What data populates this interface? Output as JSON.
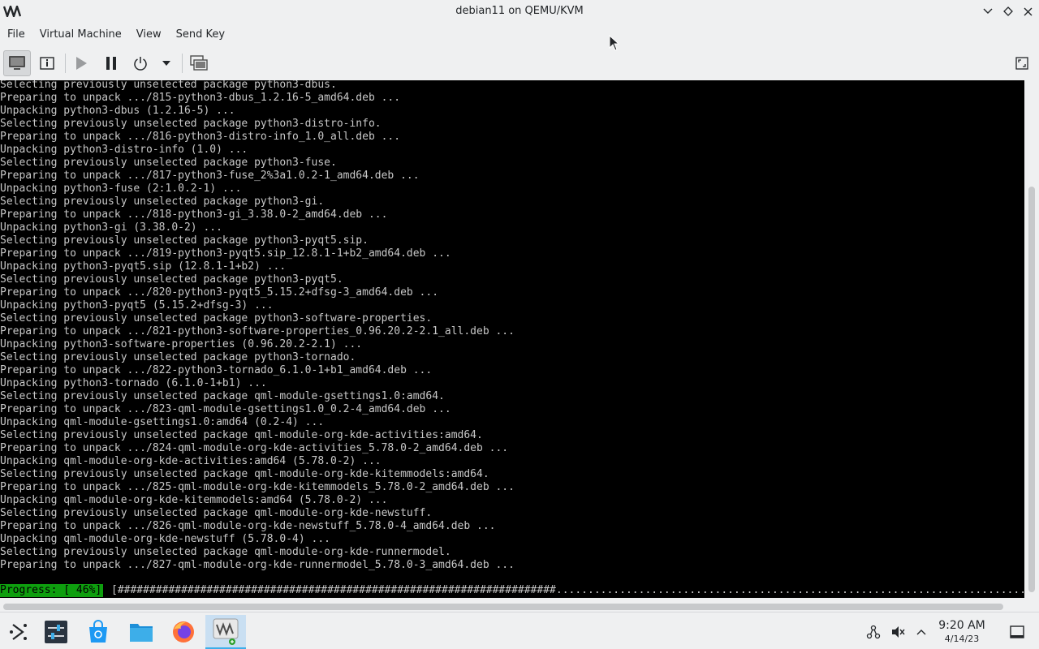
{
  "window": {
    "title": "debian11 on QEMU/KVM"
  },
  "menu": {
    "items": [
      "File",
      "Virtual Machine",
      "View",
      "Send Key"
    ]
  },
  "toolbar": {
    "buttons": [
      "console-view",
      "details-view",
      "run",
      "pause",
      "shutdown",
      "shutdown-menu",
      "snapshots",
      "fullscreen"
    ]
  },
  "console": {
    "lines": [
      "Selecting previously unselected package python3-dbus.",
      "Preparing to unpack .../815-python3-dbus_1.2.16-5_amd64.deb ...",
      "Unpacking python3-dbus (1.2.16-5) ...",
      "Selecting previously unselected package python3-distro-info.",
      "Preparing to unpack .../816-python3-distro-info_1.0_all.deb ...",
      "Unpacking python3-distro-info (1.0) ...",
      "Selecting previously unselected package python3-fuse.",
      "Preparing to unpack .../817-python3-fuse_2%3a1.0.2-1_amd64.deb ...",
      "Unpacking python3-fuse (2:1.0.2-1) ...",
      "Selecting previously unselected package python3-gi.",
      "Preparing to unpack .../818-python3-gi_3.38.0-2_amd64.deb ...",
      "Unpacking python3-gi (3.38.0-2) ...",
      "Selecting previously unselected package python3-pyqt5.sip.",
      "Preparing to unpack .../819-python3-pyqt5.sip_12.8.1-1+b2_amd64.deb ...",
      "Unpacking python3-pyqt5.sip (12.8.1-1+b2) ...",
      "Selecting previously unselected package python3-pyqt5.",
      "Preparing to unpack .../820-python3-pyqt5_5.15.2+dfsg-3_amd64.deb ...",
      "Unpacking python3-pyqt5 (5.15.2+dfsg-3) ...",
      "Selecting previously unselected package python3-software-properties.",
      "Preparing to unpack .../821-python3-software-properties_0.96.20.2-2.1_all.deb ...",
      "Unpacking python3-software-properties (0.96.20.2-2.1) ...",
      "Selecting previously unselected package python3-tornado.",
      "Preparing to unpack .../822-python3-tornado_6.1.0-1+b1_amd64.deb ...",
      "Unpacking python3-tornado (6.1.0-1+b1) ...",
      "Selecting previously unselected package qml-module-gsettings1.0:amd64.",
      "Preparing to unpack .../823-qml-module-gsettings1.0_0.2-4_amd64.deb ...",
      "Unpacking qml-module-gsettings1.0:amd64 (0.2-4) ...",
      "Selecting previously unselected package qml-module-org-kde-activities:amd64.",
      "Preparing to unpack .../824-qml-module-org-kde-activities_5.78.0-2_amd64.deb ...",
      "Unpacking qml-module-org-kde-activities:amd64 (5.78.0-2) ...",
      "Selecting previously unselected package qml-module-org-kde-kitemmodels:amd64.",
      "Preparing to unpack .../825-qml-module-org-kde-kitemmodels_5.78.0-2_amd64.deb ...",
      "Unpacking qml-module-org-kde-kitemmodels:amd64 (5.78.0-2) ...",
      "Selecting previously unselected package qml-module-org-kde-newstuff.",
      "Preparing to unpack .../826-qml-module-org-kde-newstuff_5.78.0-4_amd64.deb ...",
      "Unpacking qml-module-org-kde-newstuff (5.78.0-4) ...",
      "Selecting previously unselected package qml-module-org-kde-runnermodel.",
      "Preparing to unpack .../827-qml-module-org-kde-runnermodel_5.78.0-3_amd64.deb ..."
    ],
    "progress_label": "Progress: [ 46%]",
    "progress_bar": "[#####################################################################.................................................................................]",
    "progress_percent": 46
  },
  "taskbar": {
    "apps": [
      "application-launcher-icon",
      "system-settings-icon",
      "discover-store-icon",
      "file-manager-icon",
      "firefox-icon",
      "virt-manager-icon"
    ],
    "clock_time": "9:20 AM",
    "clock_date": "4/14/23"
  },
  "colors": {
    "progress_green": "#0e9e0e",
    "console_bg": "#000000",
    "console_text": "#c8c8c8",
    "active_task": "#3daee9"
  }
}
